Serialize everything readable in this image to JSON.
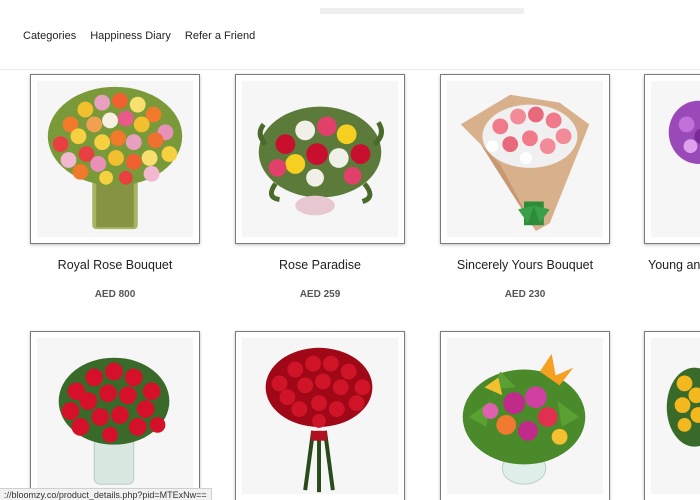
{
  "nav": {
    "items": [
      "Categories",
      "Happiness Diary",
      "Refer a Friend"
    ]
  },
  "products": [
    {
      "name": "Royal Rose Bouquet",
      "price": "AED 800",
      "image": "mixed-rose-vase-image"
    },
    {
      "name": "Rose Paradise",
      "price": "AED 259",
      "image": "rose-paradise-image"
    },
    {
      "name": "Sincerely Yours Bouquet",
      "price": "AED 230",
      "image": "wrapped-pink-bouquet-image"
    },
    {
      "name": "Young and",
      "price": "",
      "image": "purple-bouquet-image"
    },
    {
      "name": "",
      "price": "",
      "image": "red-roses-vase-image"
    },
    {
      "name": "",
      "price": "",
      "image": "red-rose-bunch-image"
    },
    {
      "name": "",
      "price": "",
      "image": "lily-orchid-vase-image"
    },
    {
      "name": "",
      "price": "",
      "image": "yellow-roses-image"
    }
  ],
  "status_bar": {
    "url": "://bloomzy.co/product_details.php?pid=MTExNw=="
  }
}
